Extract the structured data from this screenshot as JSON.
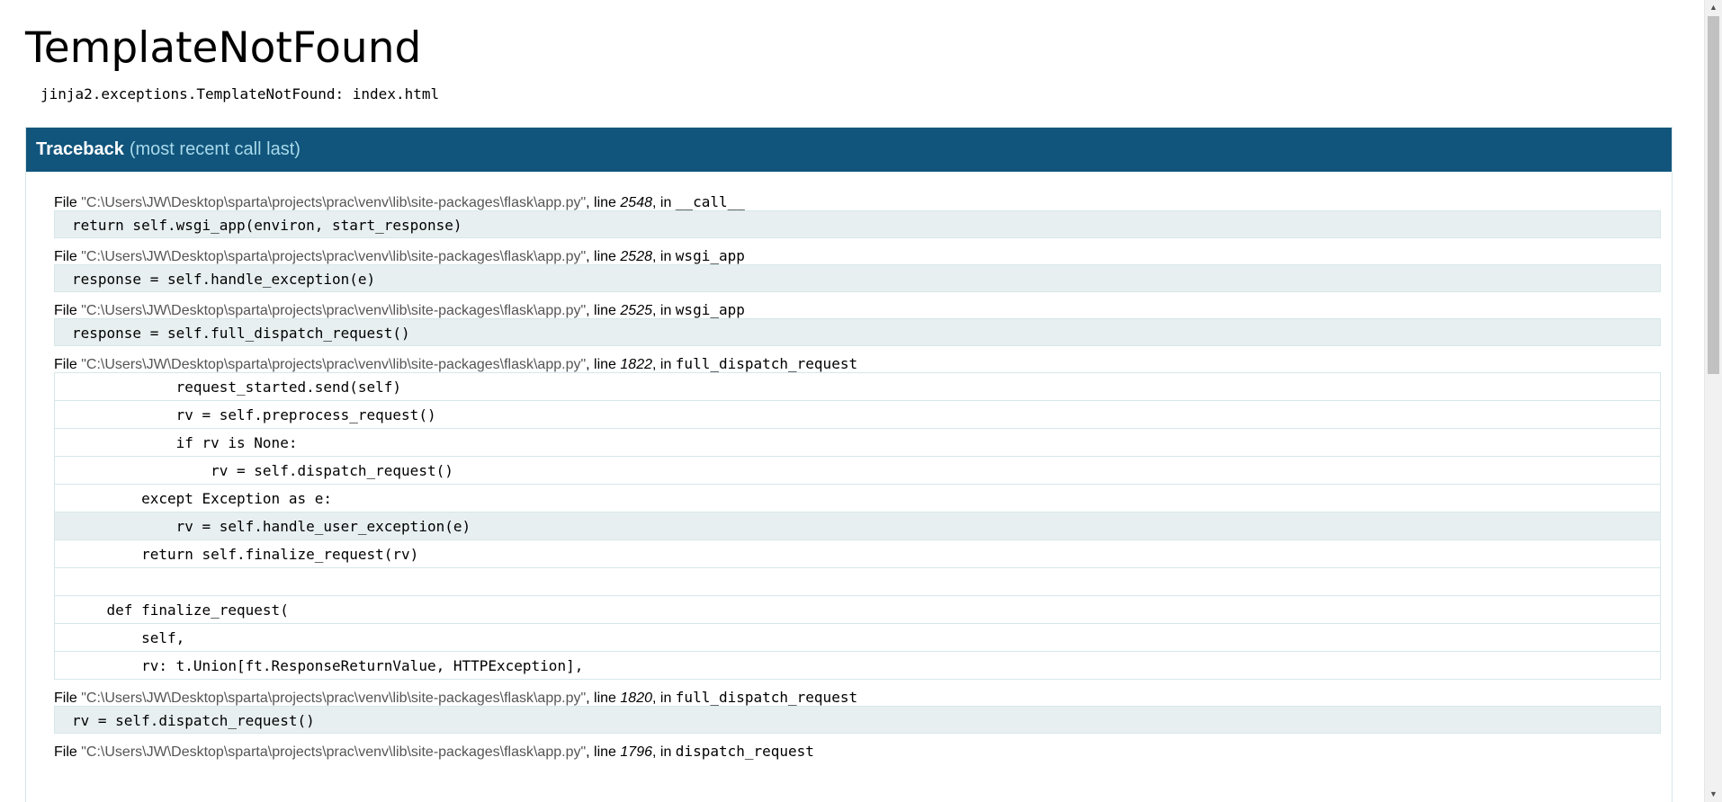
{
  "error": {
    "title": "TemplateNotFound",
    "message": "jinja2.exceptions.TemplateNotFound: index.html"
  },
  "traceback": {
    "title": "Traceback",
    "subtitle": "(most recent call last)",
    "frames": [
      {
        "file_prefix": "File ",
        "filename": "\"C:\\Users\\JW\\Desktop\\sparta\\projects\\prac\\venv\\lib\\site-packages\\flask\\app.py\"",
        "line_prefix": ", line ",
        "lineno": "2548",
        "in_prefix": ", in ",
        "function": "__call__",
        "code": "return self.wsgi_app(environ, start_response)"
      },
      {
        "file_prefix": "File ",
        "filename": "\"C:\\Users\\JW\\Desktop\\sparta\\projects\\prac\\venv\\lib\\site-packages\\flask\\app.py\"",
        "line_prefix": ", line ",
        "lineno": "2528",
        "in_prefix": ", in ",
        "function": "wsgi_app",
        "code": "response = self.handle_exception(e)"
      },
      {
        "file_prefix": "File ",
        "filename": "\"C:\\Users\\JW\\Desktop\\sparta\\projects\\prac\\venv\\lib\\site-packages\\flask\\app.py\"",
        "line_prefix": ", line ",
        "lineno": "2525",
        "in_prefix": ", in ",
        "function": "wsgi_app",
        "code": "response = self.full_dispatch_request()"
      },
      {
        "file_prefix": "File ",
        "filename": "\"C:\\Users\\JW\\Desktop\\sparta\\projects\\prac\\venv\\lib\\site-packages\\flask\\app.py\"",
        "line_prefix": ", line ",
        "lineno": "1822",
        "in_prefix": ", in ",
        "function": "full_dispatch_request",
        "lines": [
          "            request_started.send(self)",
          "            rv = self.preprocess_request()",
          "            if rv is None:",
          "                rv = self.dispatch_request()",
          "        except Exception as e:",
          "            rv = self.handle_user_exception(e)",
          "        return self.finalize_request(rv)",
          "",
          "    def finalize_request(",
          "        self,",
          "        rv: t.Union[ft.ResponseReturnValue, HTTPException],"
        ]
      },
      {
        "file_prefix": "File ",
        "filename": "\"C:\\Users\\JW\\Desktop\\sparta\\projects\\prac\\venv\\lib\\site-packages\\flask\\app.py\"",
        "line_prefix": ", line ",
        "lineno": "1820",
        "in_prefix": ", in ",
        "function": "full_dispatch_request",
        "code": "rv = self.dispatch_request()"
      },
      {
        "file_prefix": "File ",
        "filename": "\"C:\\Users\\JW\\Desktop\\sparta\\projects\\prac\\venv\\lib\\site-packages\\flask\\app.py\"",
        "line_prefix": ", line ",
        "lineno": "1796",
        "in_prefix": ", in ",
        "function": "dispatch_request",
        "code": ""
      }
    ]
  },
  "scrollbar": {
    "up_icon": "▲",
    "down_icon": "▼"
  },
  "colors": {
    "header_bg": "#11557c",
    "code_bg": "#e8eff0",
    "border": "#d6e7ea",
    "subtitle": "#a8d9ea"
  }
}
